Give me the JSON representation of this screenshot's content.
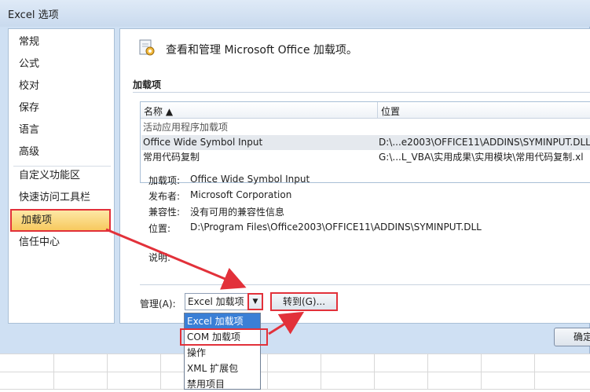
{
  "window": {
    "title": "Excel 选项"
  },
  "sidebar": {
    "items": [
      {
        "label": "常规"
      },
      {
        "label": "公式"
      },
      {
        "label": "校对"
      },
      {
        "label": "保存"
      },
      {
        "label": "语言"
      },
      {
        "label": "高级"
      },
      {
        "label": "自定义功能区"
      },
      {
        "label": "快速访问工具栏"
      },
      {
        "label": "加载项"
      },
      {
        "label": "信任中心"
      }
    ],
    "selected": "加载项"
  },
  "main": {
    "header": "查看和管理 Microsoft Office 加载项。",
    "section_title": "加载项",
    "columns": {
      "name": "名称 ▲",
      "location": "位置"
    },
    "rows": [
      {
        "name": "活动应用程序加载项",
        "location": ""
      },
      {
        "name": "Office Wide Symbol Input",
        "location": "D:\\...e2003\\OFFICE11\\ADDINS\\SYMINPUT.DLL"
      },
      {
        "name": "常用代码复制",
        "location": "G:\\...L_VBA\\实用成果\\实用模块\\常用代码复制.xl"
      }
    ],
    "details": {
      "addin_label": "加载项:",
      "addin_value": "Office Wide Symbol Input",
      "publisher_label": "发布者:",
      "publisher_value": "Microsoft Corporation",
      "compat_label": "兼容性:",
      "compat_value": "没有可用的兼容性信息",
      "location_label": "位置:",
      "location_value": "D:\\Program Files\\Office2003\\OFFICE11\\ADDINS\\SYMINPUT.DLL",
      "desc_label": "说明:"
    },
    "manage_label": "管理(A):",
    "manage_value": "Excel 加载项",
    "goto_label": "转到(G)...",
    "dropdown_options": [
      "Excel 加载项",
      "COM 加载项",
      "操作",
      "XML 扩展包",
      "禁用项目"
    ],
    "ok_label": "确定"
  },
  "colors": {
    "highlight_red": "#e2313a",
    "selection_blue": "#3a7fd6",
    "selected_nav": "#f7c95e"
  }
}
